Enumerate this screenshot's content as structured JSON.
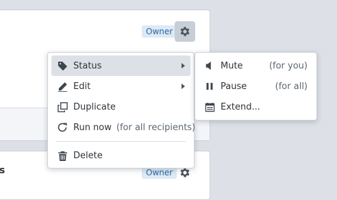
{
  "cards": [
    {
      "badge": "Owner"
    },
    {
      "badge": "Owner",
      "title_fragment": "s"
    }
  ],
  "menu": {
    "items": [
      {
        "label": "Status",
        "icon": "tag-icon",
        "has_submenu": true,
        "active": true
      },
      {
        "label": "Edit",
        "icon": "pencil-icon",
        "has_submenu": true
      },
      {
        "label": "Duplicate",
        "icon": "duplicate-icon"
      },
      {
        "label": "Run now",
        "hint": "(for all recipients)",
        "icon": "refresh-icon"
      },
      {
        "label": "Delete",
        "icon": "trash-icon"
      }
    ]
  },
  "submenu": {
    "items": [
      {
        "label": "Mute",
        "hint": "(for you)",
        "icon": "speaker-icon"
      },
      {
        "label": "Pause",
        "hint": "(for all)",
        "icon": "pause-icon"
      },
      {
        "label": "Extend...",
        "icon": "calendar-icon"
      }
    ]
  },
  "colors": {
    "background": "#dde1e7",
    "badge_bg": "#dde9f4",
    "badge_text": "#2a66a3",
    "active_item": "#dde1e7"
  }
}
